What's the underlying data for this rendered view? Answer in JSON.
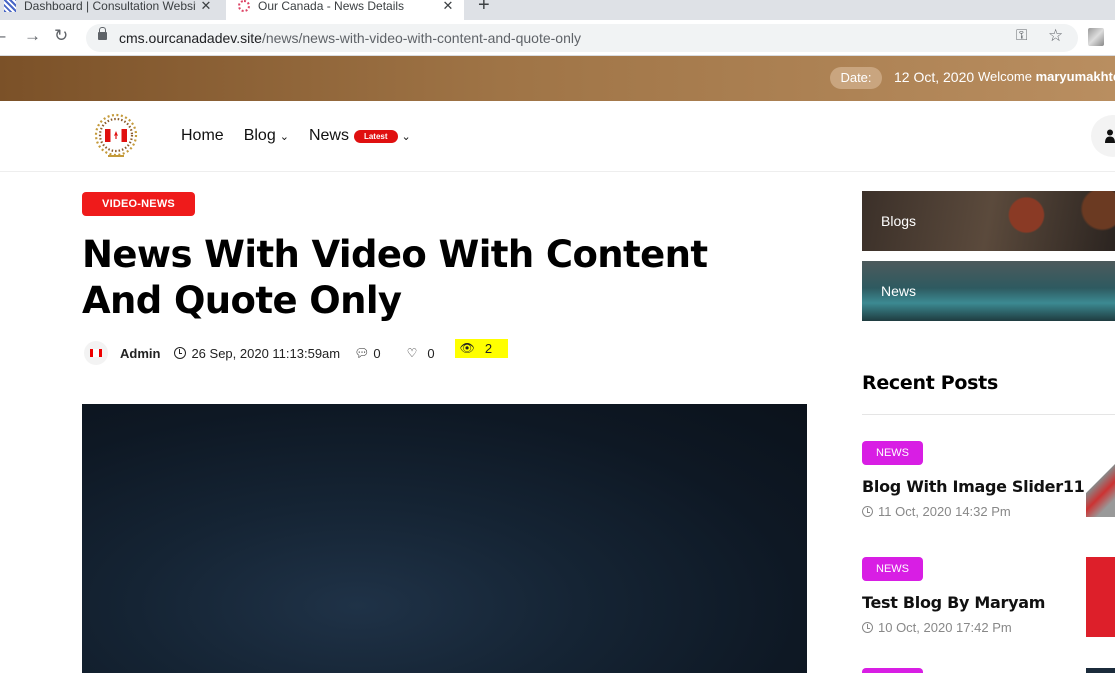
{
  "browser": {
    "tabs": [
      {
        "title": "Dashboard | Consultation Websit"
      },
      {
        "title": "Our Canada - News Details"
      }
    ],
    "url": {
      "host": "cms.ourcanadadev.site",
      "path": "/news/news-with-video-with-content-and-quote-only"
    }
  },
  "topbar": {
    "date_label": "Date:",
    "date_value": "12 Oct, 2020",
    "welcome_prefix": "Welcome",
    "welcome_user": "maryumakhte"
  },
  "nav": {
    "home": "Home",
    "blog": "Blog",
    "news": "News",
    "news_badge": "Latest"
  },
  "article": {
    "category": "VIDEO-NEWS",
    "title": "News With Video With Content And Quote Only",
    "author": "Admin",
    "date": "26 Sep, 2020 11:13:59am",
    "comments": "0",
    "likes": "0",
    "views": "2"
  },
  "sidebar": {
    "categories": [
      {
        "label": "Blogs"
      },
      {
        "label": "News"
      }
    ],
    "recent_heading": "Recent Posts",
    "posts": [
      {
        "tag": "NEWS",
        "title": "Blog With Image Slider11",
        "date": "11 Oct, 2020 14:32 Pm"
      },
      {
        "tag": "NEWS",
        "title": "Test Blog By Maryam",
        "date": "10 Oct, 2020 17:42 Pm"
      }
    ]
  },
  "colors": {
    "category_badge": "#ef1b1b",
    "news_tag": "#d81ee4",
    "views_highlight": "#ffff00",
    "topbar_start": "#7b5128",
    "topbar_end": "#b98e60"
  }
}
